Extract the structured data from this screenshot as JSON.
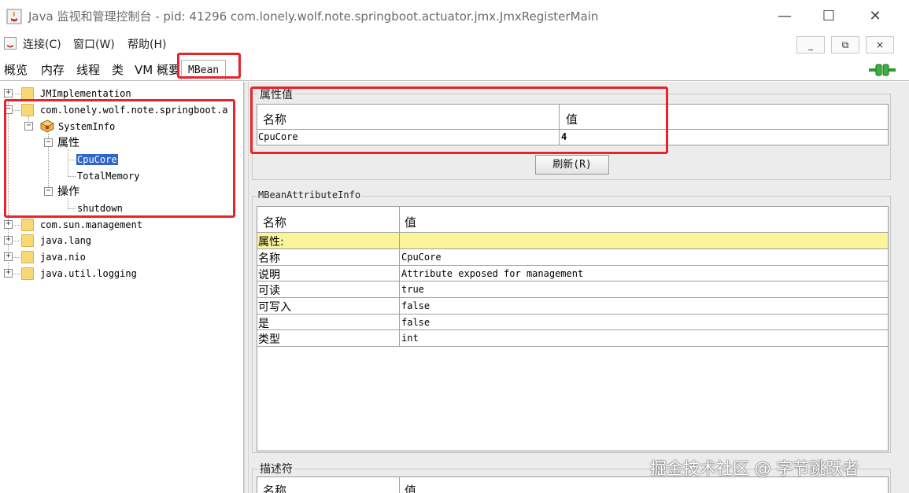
{
  "window": {
    "title": "Java 监视和管理控制台 - pid: 41296 com.lonely.wolf.note.springboot.actuator.jmx.JmxRegisterMain",
    "controls": {
      "minimize": "—",
      "maximize": "☐",
      "close": "✕"
    }
  },
  "menu": {
    "items": [
      "连接(C)",
      "窗口(W)",
      "帮助(H)"
    ],
    "mdi": {
      "minimize": "_",
      "restore": "⧉",
      "close": "×"
    }
  },
  "tabs": [
    "概览",
    "内存",
    "线程",
    "类",
    "VM 概要",
    "MBean"
  ],
  "active_tab": "MBean",
  "tree": {
    "jmimplementation": "JMImplementation",
    "app_domain": "com.lonely.wolf.note.springboot.a",
    "systeminfo": "SystemInfo",
    "attributes_label": "属性",
    "cpucore": "CpuCore",
    "totalmemory": "TotalMemory",
    "operations_label": "操作",
    "shutdown": "shutdown",
    "sun_management": "com.sun.management",
    "java_lang": "java.lang",
    "java_nio": "java.nio",
    "java_util_logging": "java.util.logging",
    "expand_symbol": "+",
    "collapse_symbol": "−"
  },
  "attr_values": {
    "title": "属性值",
    "header_name": "名称",
    "header_value": "值",
    "row_name": "CpuCore",
    "row_value": "4"
  },
  "refresh_button": "刷新(R)",
  "attr_info": {
    "title": "MBeanAttributeInfo",
    "header_name": "名称",
    "header_value": "值",
    "rows": [
      {
        "name": "属性:",
        "value": ""
      },
      {
        "name": "名称",
        "value": "CpuCore"
      },
      {
        "name": "说明",
        "value": "Attribute exposed for management"
      },
      {
        "name": "可读",
        "value": "true"
      },
      {
        "name": "可写入",
        "value": "false"
      },
      {
        "name": "是",
        "value": "false"
      },
      {
        "name": "类型",
        "value": "int"
      }
    ]
  },
  "descriptor": {
    "title": "描述符",
    "header_name": "名称",
    "header_value": "值"
  },
  "watermark": "掘金技术社区 @ 字节跳跃者",
  "colors": {
    "highlight_red": "#e8232a",
    "selection_blue": "#2f65c9",
    "section_yellow": "#fbf59a",
    "folder_yellow": "#f8d775"
  }
}
